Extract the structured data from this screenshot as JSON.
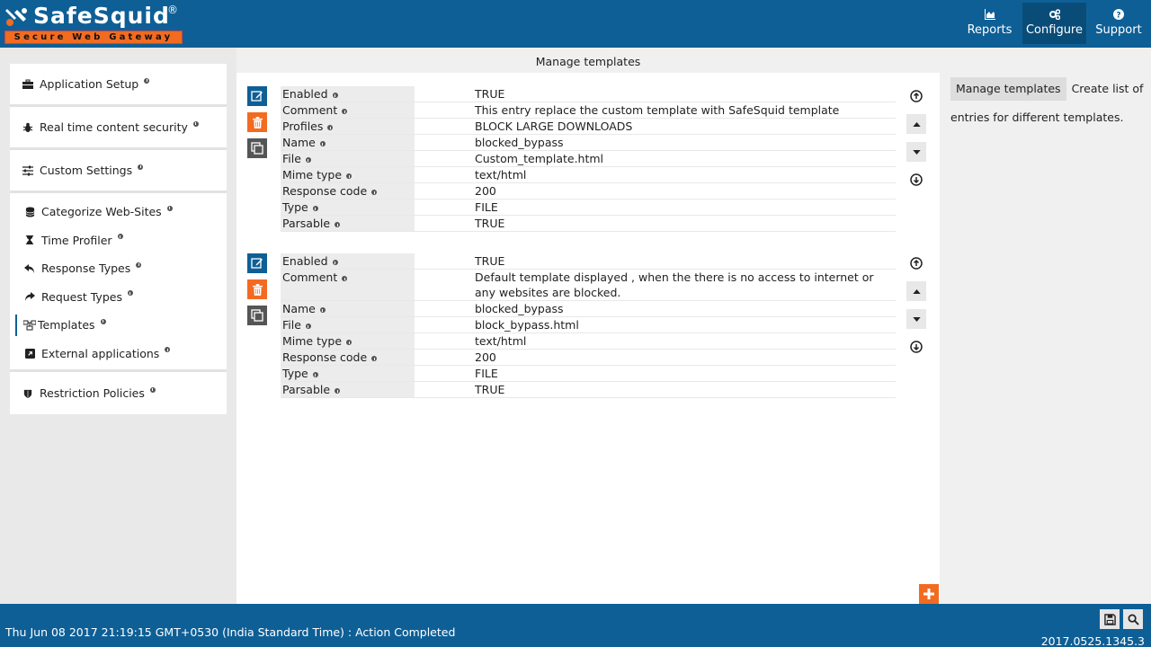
{
  "header": {
    "logo_text": "SafeSquid",
    "logo_reg": "®",
    "logo_tagline": "Secure Web Gateway",
    "nav": [
      {
        "label": "Reports",
        "icon": "area-chart-icon"
      },
      {
        "label": "Configure",
        "icon": "cogs-icon"
      },
      {
        "label": "Support",
        "icon": "question-circle-icon"
      }
    ]
  },
  "sidebar": {
    "top": [
      {
        "label": "Application Setup",
        "icon": "briefcase-icon"
      },
      {
        "label": "Real time content security",
        "icon": "bug-icon"
      },
      {
        "label": "Custom Settings",
        "icon": "sliders-icon"
      }
    ],
    "sub": [
      {
        "label": "Categorize Web-Sites",
        "icon": "database-icon"
      },
      {
        "label": "Time Profiler",
        "icon": "hourglass-icon"
      },
      {
        "label": "Response Types",
        "icon": "reply-icon"
      },
      {
        "label": "Request Types",
        "icon": "share-icon"
      },
      {
        "label": "Templates",
        "icon": "sitemap-icon"
      },
      {
        "label": "External applications",
        "icon": "external-link-icon"
      }
    ],
    "bottom": [
      {
        "label": "Restriction Policies",
        "icon": "shield-icon"
      }
    ]
  },
  "main": {
    "title": "Manage templates",
    "entries": [
      {
        "rows": [
          {
            "key": "Enabled",
            "value": "TRUE"
          },
          {
            "key": "Comment",
            "value": "This entry replace the custom template with SafeSquid template"
          },
          {
            "key": "Profiles",
            "value": "BLOCK LARGE DOWNLOADS"
          },
          {
            "key": "Name",
            "value": "blocked_bypass"
          },
          {
            "key": "File",
            "value": "Custom_template.html"
          },
          {
            "key": "Mime type",
            "value": "text/html"
          },
          {
            "key": "Response code",
            "value": "200"
          },
          {
            "key": "Type",
            "value": "FILE"
          },
          {
            "key": "Parsable",
            "value": "TRUE"
          }
        ]
      },
      {
        "rows": [
          {
            "key": "Enabled",
            "value": "TRUE"
          },
          {
            "key": "Comment",
            "value": "Default template displayed , when the there is no access to internet or any websites are blocked."
          },
          {
            "key": "Name",
            "value": "blocked_bypass"
          },
          {
            "key": "File",
            "value": "block_bypass.html"
          },
          {
            "key": "Mime type",
            "value": "text/html"
          },
          {
            "key": "Response code",
            "value": "200"
          },
          {
            "key": "Type",
            "value": "FILE"
          },
          {
            "key": "Parsable",
            "value": "TRUE"
          }
        ]
      }
    ]
  },
  "help": {
    "tag": "Manage templates",
    "text": "Create list of entries for different templates."
  },
  "footer": {
    "status": "Thu Jun 08 2017 21:19:15 GMT+0530 (India Standard Time) : Action Completed",
    "version": "2017.0525.1345.3"
  },
  "colors": {
    "primary": "#0e5f96",
    "accent": "#f26b21",
    "dark": "#555555"
  }
}
